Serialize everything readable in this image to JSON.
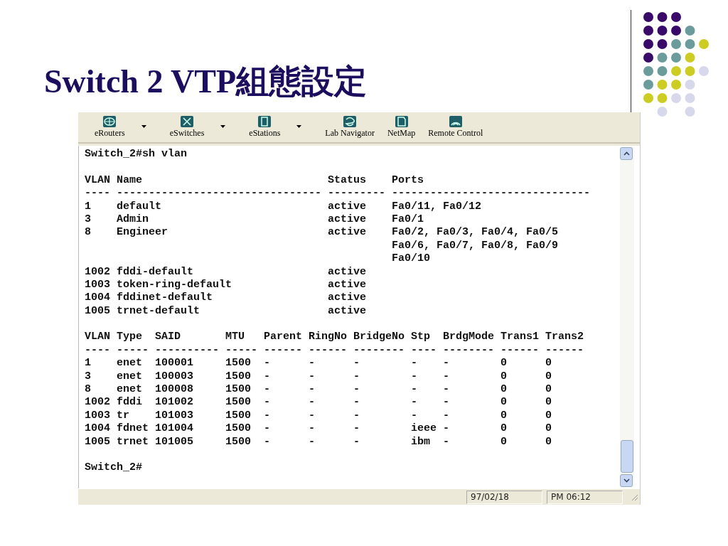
{
  "slide": {
    "title": "Switch 2 VTP組態設定"
  },
  "toolbar": [
    {
      "label": "eRouters",
      "dropdown": true
    },
    {
      "label": "eSwitches",
      "dropdown": true
    },
    {
      "label": "eStations",
      "dropdown": true
    },
    {
      "label": "Lab Navigator",
      "dropdown": false
    },
    {
      "label": "NetMap",
      "dropdown": false
    },
    {
      "label": "Remote Control",
      "dropdown": false
    }
  ],
  "terminal": {
    "blocks": [
      [
        "Switch_2#sh vlan"
      ],
      [
        "VLAN Name                             Status    Ports",
        "---- -------------------------------- --------- -------------------------------",
        "1    default                          active    Fa0/11, Fa0/12",
        "3    Admin                            active    Fa0/1",
        "8    Engineer                         active    Fa0/2, Fa0/3, Fa0/4, Fa0/5",
        "                                                Fa0/6, Fa0/7, Fa0/8, Fa0/9",
        "                                                Fa0/10",
        "1002 fddi-default                     active",
        "1003 token-ring-default               active",
        "1004 fddinet-default                  active",
        "1005 trnet-default                    active"
      ],
      [
        "VLAN Type  SAID       MTU   Parent RingNo BridgeNo Stp  BrdgMode Trans1 Trans2",
        "---- ----- ---------- ----- ------ ------ -------- ---- -------- ------ ------",
        "1    enet  100001     1500  -      -      -        -    -        0      0",
        "3    enet  100003     1500  -      -      -        -    -        0      0",
        "8    enet  100008     1500  -      -      -        -    -        0      0",
        "1002 fddi  101002     1500  -      -      -        -    -        0      0",
        "1003 tr    101003     1500  -      -      -        -    -        0      0",
        "1004 fdnet 101004     1500  -      -      -        ieee -        0      0",
        "1005 trnet 101005     1500  -      -      -        ibm  -        0      0"
      ],
      [
        "Switch_2#"
      ]
    ]
  },
  "status_bar": {
    "date": "97/02/18",
    "time": "PM 06:12"
  }
}
